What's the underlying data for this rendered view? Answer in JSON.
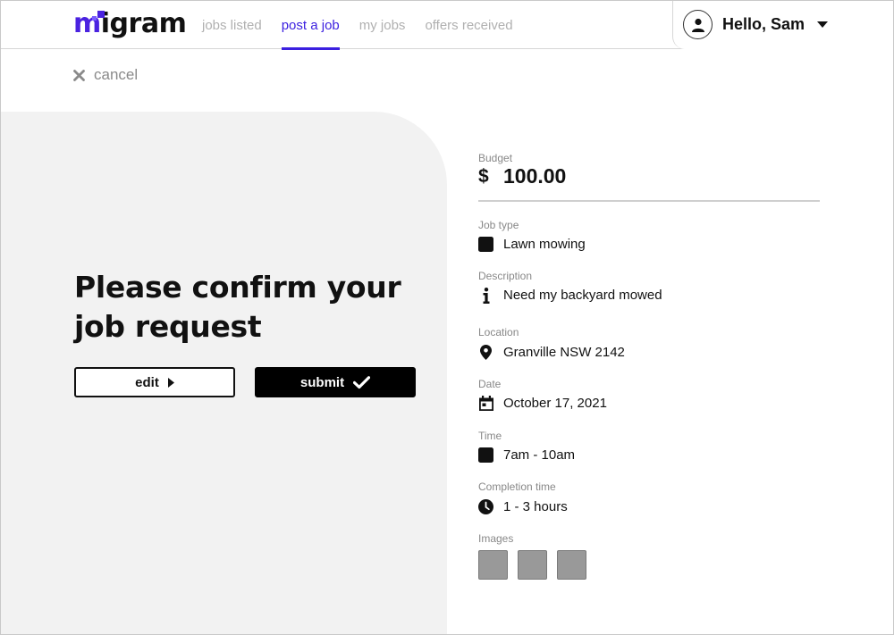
{
  "header": {
    "logo": {
      "accent": "m",
      "rest": "igram",
      "accent_color": "#4a22e0"
    },
    "nav": [
      {
        "label": "jobs listed",
        "active": false
      },
      {
        "label": "post a job",
        "active": true
      },
      {
        "label": "my jobs",
        "active": false
      },
      {
        "label": "offers received",
        "active": false
      }
    ],
    "user": {
      "greeting": "Hello, Sam",
      "avatar_icon": "user-icon",
      "menu_icon": "caret-down-icon"
    }
  },
  "cancel": {
    "label": "cancel",
    "icon": "close-icon"
  },
  "confirm": {
    "heading": "Please confirm your job request",
    "edit_label": "edit",
    "edit_icon": "play-right-icon",
    "submit_label": "submit",
    "submit_icon": "check-icon"
  },
  "details": {
    "budget": {
      "label": "Budget",
      "currency": "$",
      "amount": "100.00"
    },
    "job_type": {
      "label": "Job type",
      "value": "Lawn mowing",
      "icon": "square-icon"
    },
    "description": {
      "label": "Description",
      "value": "Need my backyard mowed",
      "icon": "info-icon"
    },
    "location": {
      "label": "Location",
      "value": "Granville NSW 2142",
      "icon": "map-pin-icon"
    },
    "date": {
      "label": "Date",
      "value": "October 17, 2021",
      "icon": "calendar-icon"
    },
    "time": {
      "label": "Time",
      "value": "7am - 10am",
      "icon": "square-icon"
    },
    "completion": {
      "label": "Completion time",
      "value": "1 - 3 hours",
      "icon": "clock-icon"
    },
    "images": {
      "label": "Images",
      "count": 3
    }
  },
  "colors": {
    "brand": "#4a22e0",
    "nav_active": "#3b1fe0",
    "panel_bg": "#f2f2f2",
    "image_placeholder": "#999999"
  }
}
